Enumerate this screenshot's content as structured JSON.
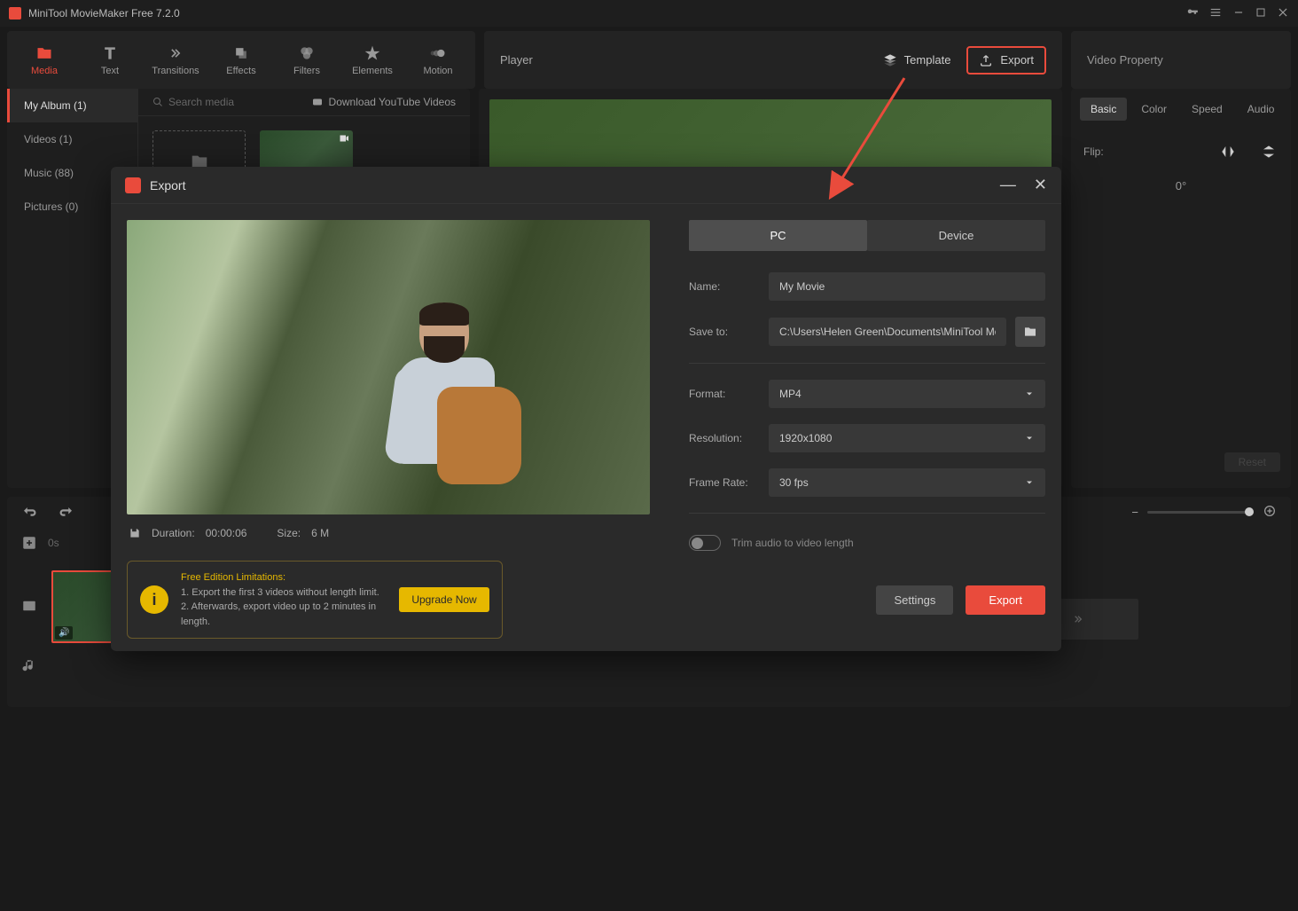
{
  "app": {
    "title": "MiniTool MovieMaker Free 7.2.0"
  },
  "toolbar": [
    {
      "label": "Media",
      "active": true
    },
    {
      "label": "Text",
      "active": false
    },
    {
      "label": "Transitions",
      "active": false
    },
    {
      "label": "Effects",
      "active": false
    },
    {
      "label": "Filters",
      "active": false
    },
    {
      "label": "Elements",
      "active": false
    },
    {
      "label": "Motion",
      "active": false
    }
  ],
  "center": {
    "player_label": "Player",
    "template_label": "Template",
    "export_label": "Export"
  },
  "rightpanel": {
    "title": "Video Property",
    "tabs": [
      "Basic",
      "Color",
      "Speed",
      "Audio"
    ],
    "flip_label": "Flip:",
    "rotation": "0°",
    "reset": "Reset"
  },
  "sidebar": {
    "items": [
      {
        "label": "My Album (1)",
        "active": true
      },
      {
        "label": "Videos (1)",
        "active": false
      },
      {
        "label": "Music (88)",
        "active": false
      },
      {
        "label": "Pictures (0)",
        "active": false
      }
    ],
    "search_placeholder": "Search media",
    "download_label": "Download YouTube Videos"
  },
  "timeline": {
    "start": "0s"
  },
  "export": {
    "dialog_title": "Export",
    "tabs": {
      "pc": "PC",
      "device": "Device"
    },
    "fields": {
      "name_label": "Name:",
      "name_value": "My Movie",
      "save_label": "Save to:",
      "save_value": "C:\\Users\\Helen Green\\Documents\\MiniTool MovieM",
      "format_label": "Format:",
      "format_value": "MP4",
      "resolution_label": "Resolution:",
      "resolution_value": "1920x1080",
      "framerate_label": "Frame Rate:",
      "framerate_value": "30 fps",
      "trim_label": "Trim audio to video length"
    },
    "duration_label": "Duration:",
    "duration_value": "00:00:06",
    "size_label": "Size:",
    "size_value": "6 M",
    "limitations": {
      "heading": "Free Edition Limitations:",
      "line1": "1. Export the first 3 videos without length limit.",
      "line2": "2. Afterwards, export video up to 2 minutes in length.",
      "upgrade": "Upgrade Now"
    },
    "settings_btn": "Settings",
    "export_btn": "Export"
  }
}
